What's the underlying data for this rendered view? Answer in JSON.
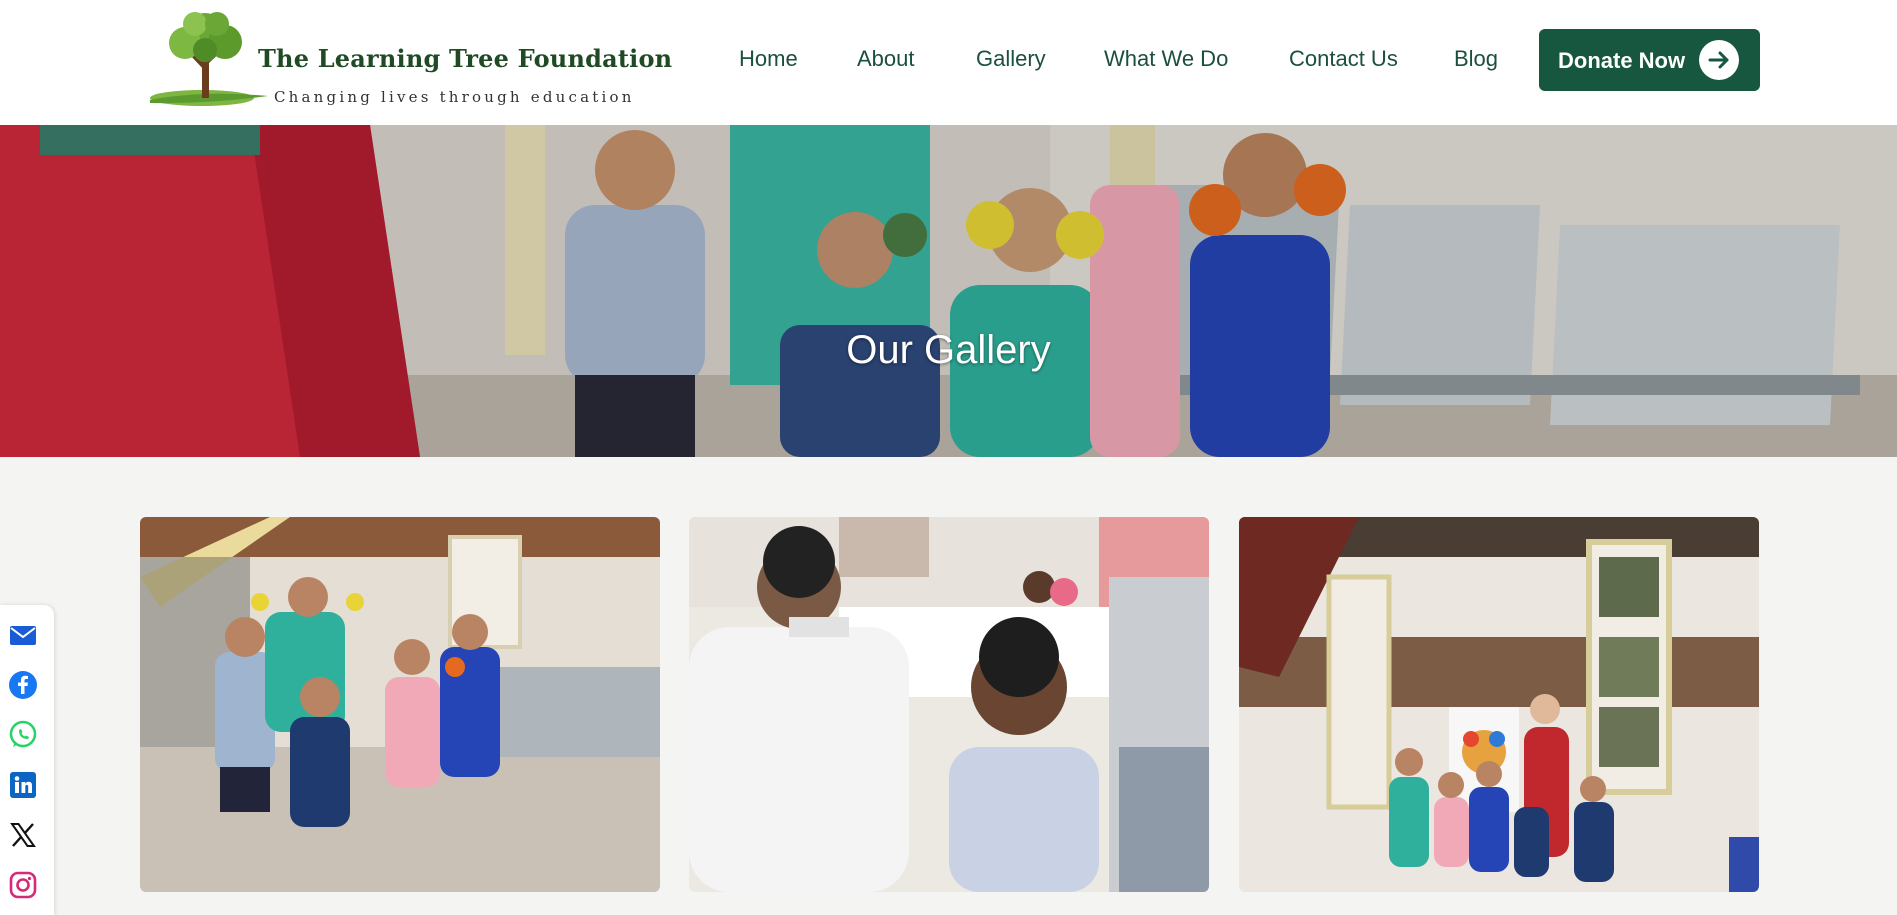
{
  "header": {
    "logo_title": "The Learning Tree Foundation",
    "logo_tagline": "Changing lives through education"
  },
  "nav": {
    "items": [
      {
        "label": "Home"
      },
      {
        "label": "About"
      },
      {
        "label": "Gallery"
      },
      {
        "label": "What We Do"
      },
      {
        "label": "Contact Us"
      },
      {
        "label": "Blog"
      }
    ],
    "donate_label": "Donate Now"
  },
  "hero": {
    "title": "Our Gallery"
  },
  "gallery": {
    "photos": [
      {
        "subject": "children-with-painted-hands-in-hall"
      },
      {
        "subject": "dental-checkup"
      },
      {
        "subject": "group-with-handprint-tree-artwork"
      }
    ]
  },
  "social": {
    "icons": [
      "email-icon",
      "facebook-icon",
      "whatsapp-icon",
      "linkedin-icon",
      "x-icon",
      "instagram-icon"
    ]
  },
  "colors": {
    "brand_green": "#17563f",
    "nav_text": "#1b4f3e",
    "logo_text": "#1f4a24",
    "page_background": "#f4f4f2"
  }
}
